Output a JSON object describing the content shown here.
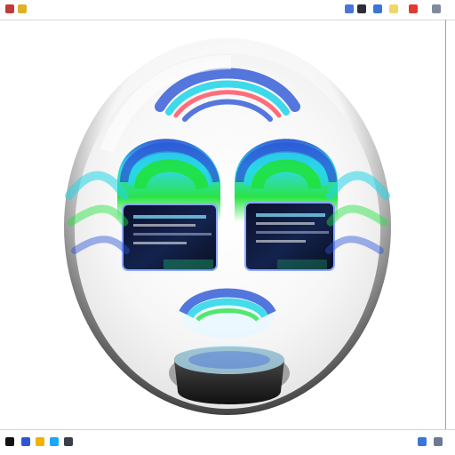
{
  "desktop": {
    "side_labels": [
      "",
      "",
      ""
    ]
  },
  "colors": {
    "accent_blue": "#2b55d6",
    "accent_green": "#1fe23d",
    "accent_cyan": "#27d6e8",
    "accent_red": "#ff4a5b",
    "base_dark": "#2a2a2a"
  },
  "icons": {
    "toolbar": [
      "app-icon",
      "window-icon",
      "folder-icon",
      "settings-icon",
      "close-icon"
    ],
    "taskbar": [
      "start-icon",
      "taskbar-app-icon",
      "taskbar-app-icon",
      "taskbar-app-icon",
      "taskbar-app-icon",
      "tray-icon",
      "tray-icon"
    ]
  }
}
